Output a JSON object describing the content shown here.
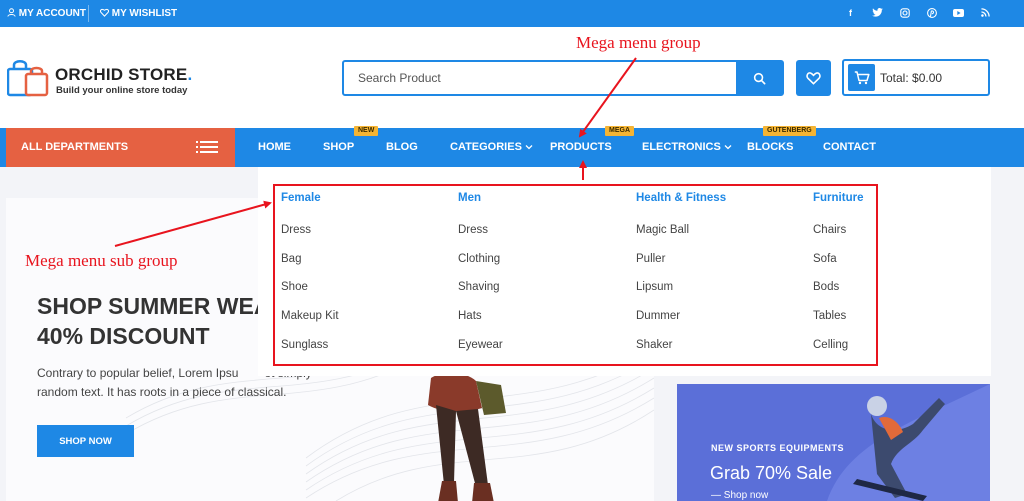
{
  "topbar": {
    "account": "MY ACCOUNT",
    "wishlist": "MY WISHLIST",
    "social_icons": [
      "facebook-icon",
      "twitter-icon",
      "instagram-icon",
      "pinterest-icon",
      "youtube-icon",
      "rss-icon"
    ]
  },
  "header": {
    "logo_title": "ORCHID STORE",
    "logo_tagline": "Build your online store today",
    "search_placeholder": "Search Product",
    "cart_total": "Total: $0.00"
  },
  "nav": {
    "departments": "ALL DEPARTMENTS",
    "items": [
      {
        "label": "HOME",
        "badge": ""
      },
      {
        "label": "SHOP",
        "badge": "NEW"
      },
      {
        "label": "BLOG",
        "badge": ""
      },
      {
        "label": "CATEGORIES",
        "badge": ""
      },
      {
        "label": "PRODUCTS",
        "badge": "MEGA"
      },
      {
        "label": "ELECTRONICS",
        "badge": ""
      },
      {
        "label": "BLOCKS",
        "badge": "GUTENBERG"
      },
      {
        "label": "CONTACT",
        "badge": ""
      }
    ],
    "dropdown_icon": "chevron-down-icon"
  },
  "megamenu": {
    "groups": [
      {
        "title": "Female",
        "items": [
          "Dress",
          "Bag",
          "Shoe",
          "Makeup Kit",
          "Sunglass"
        ]
      },
      {
        "title": "Men",
        "items": [
          "Dress",
          "Clothing",
          "Shaving",
          "Hats",
          "Eyewear"
        ]
      },
      {
        "title": "Health & Fitness",
        "items": [
          "Magic Ball",
          "Puller",
          "Lipsum",
          "Dummer",
          "Shaker"
        ]
      },
      {
        "title": "Furniture",
        "items": [
          "Chairs",
          "Sofa",
          "Bods",
          "Tables",
          "Celling"
        ]
      }
    ]
  },
  "annotations": {
    "group": "Mega menu group",
    "subgroup": "Mega menu sub group",
    "color": "#e8141e"
  },
  "hero": {
    "title_line1": "SHOP SUMMER WEA",
    "title_line2": "40% DISCOUNT",
    "desc_line1": "Contrary to popular belief, Lorem Ipsu",
    "desc_line1_tail": "ot simply",
    "desc_line2": "random text. It has roots in a piece of classical.",
    "button": "SHOP NOW"
  },
  "promo": {
    "kicker": "NEW SPORTS EQUIPMENTS",
    "headline": "Grab 70% Sale",
    "link": "— Shop now"
  },
  "colors": {
    "primary": "#1e88e5",
    "departments": "#e56142",
    "badge": "#f5b433"
  }
}
